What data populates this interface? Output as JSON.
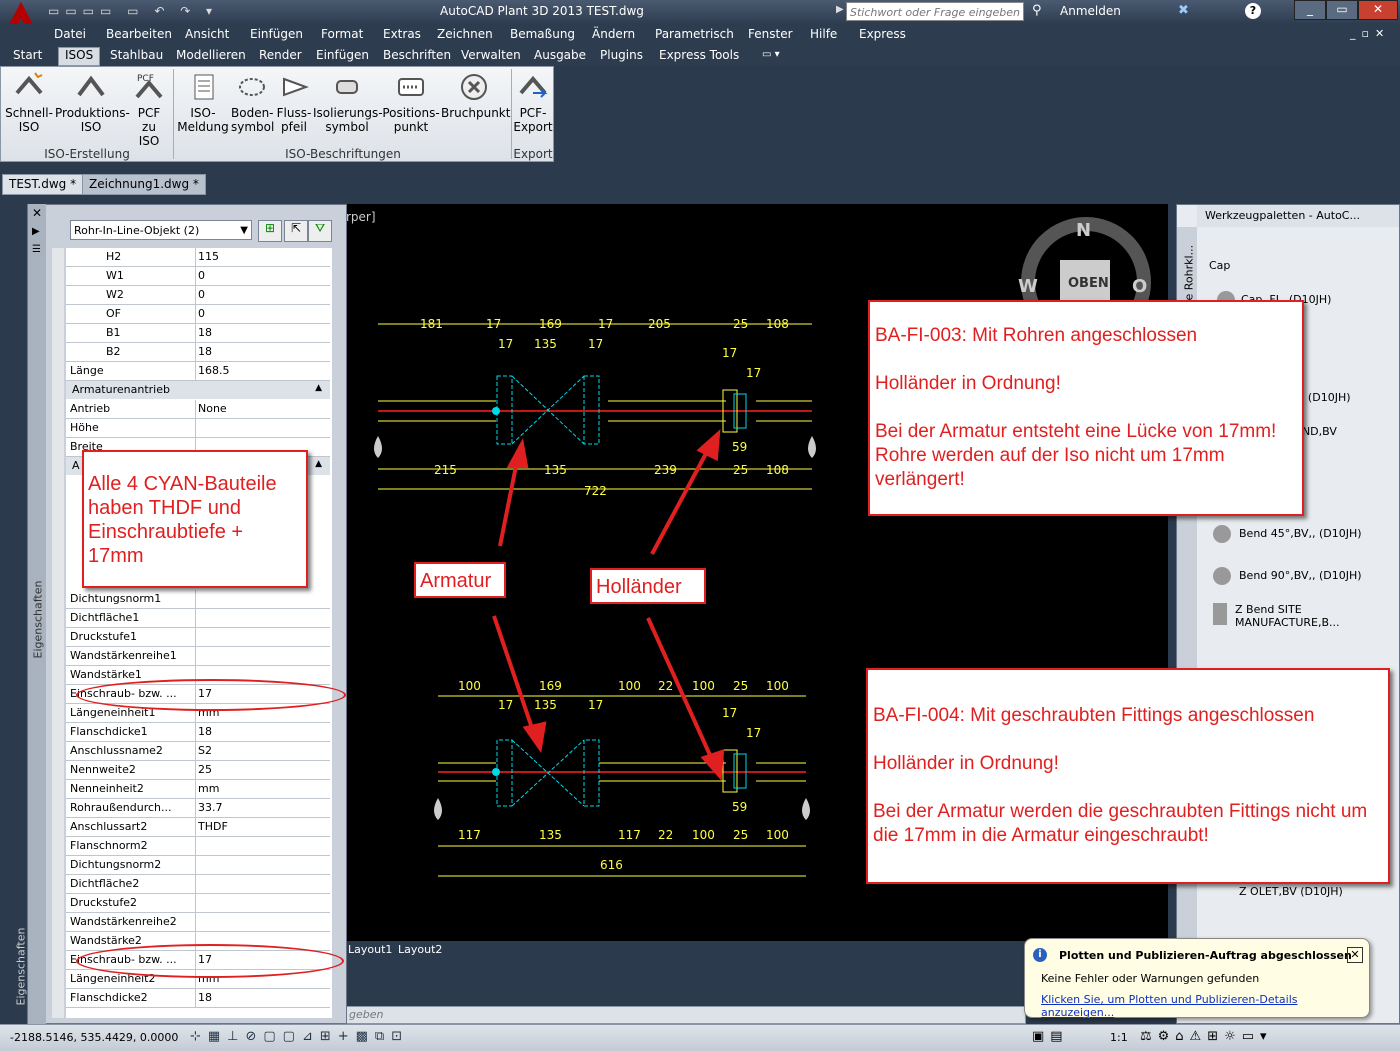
{
  "window": {
    "title": "AutoCAD Plant 3D 2013    TEST.dwg",
    "search_placeholder": "Stichwort oder Frage eingeben",
    "signin": "Anmelden",
    "help_icon": "question-icon"
  },
  "menu": [
    "Datei",
    "Bearbeiten",
    "Ansicht",
    "Einfügen",
    "Format",
    "Extras",
    "Zeichnen",
    "Bemaßung",
    "Ändern",
    "Parametrisch",
    "Fenster",
    "Hilfe",
    "Express"
  ],
  "ribbon_tabs": [
    "Start",
    "ISOS",
    "Stahlbau",
    "Modellieren",
    "Render",
    "Einfügen",
    "Beschriften",
    "Verwalten",
    "Ausgabe",
    "Plugins",
    "Express Tools"
  ],
  "ribbon": {
    "buttons": [
      {
        "l1": "Schnell-",
        "l2": "ISO"
      },
      {
        "l1": "Produktions-",
        "l2": "ISO"
      },
      {
        "l1": "PCF zu",
        "l2": "ISO"
      },
      {
        "l1": "ISO-",
        "l2": "Meldung"
      },
      {
        "l1": "Boden-",
        "l2": "symbol"
      },
      {
        "l1": "Fluss-",
        "l2": "pfeil"
      },
      {
        "l1": "Isolierungs-",
        "l2": "symbol"
      },
      {
        "l1": "Positions-",
        "l2": "punkt"
      },
      {
        "l1": "Bruchpunkt",
        "l2": ""
      },
      {
        "l1": "PCF-",
        "l2": "Export"
      }
    ],
    "groups": [
      "ISO-Erstellung",
      "ISO-Beschriftungen",
      "Export"
    ]
  },
  "doc_tabs": [
    "TEST.dwg *",
    "Zeichnung1.dwg *"
  ],
  "properties": {
    "combo": "Rohr-In-Line-Objekt (2)",
    "rows_top": [
      {
        "k": "H2",
        "v": "115"
      },
      {
        "k": "W1",
        "v": "0"
      },
      {
        "k": "W2",
        "v": "0"
      },
      {
        "k": "OF",
        "v": "0"
      },
      {
        "k": "B1",
        "v": "18"
      },
      {
        "k": "B2",
        "v": "18"
      },
      {
        "k": "Länge",
        "v": "168.5"
      }
    ],
    "group_antrieb": "Armaturenantrieb",
    "rows_antrieb": [
      {
        "k": "Antrieb",
        "v": "None"
      },
      {
        "k": "Höhe",
        "v": ""
      },
      {
        "k": "Breite",
        "v": ""
      }
    ],
    "group_a": "A",
    "rows_bottom": [
      {
        "k": "Dichtungsnorm1",
        "v": ""
      },
      {
        "k": "Dichtfläche1",
        "v": ""
      },
      {
        "k": "Druckstufe1",
        "v": ""
      },
      {
        "k": "Wandstärkenreihe1",
        "v": ""
      },
      {
        "k": "Wandstärke1",
        "v": ""
      },
      {
        "k": "Einschraub- bzw. ...",
        "v": "17"
      },
      {
        "k": "Längeneinheit1",
        "v": "mm"
      },
      {
        "k": "Flanschdicke1",
        "v": "18"
      },
      {
        "k": "Anschlussname2",
        "v": "S2"
      },
      {
        "k": "Nennweite2",
        "v": "25"
      },
      {
        "k": "Nenneinheit2",
        "v": "mm"
      },
      {
        "k": "Rohraußendurch...",
        "v": "33.7"
      },
      {
        "k": "Anschlussart2",
        "v": "THDF"
      },
      {
        "k": "Flanschnorm2",
        "v": ""
      },
      {
        "k": "Dichtungsnorm2",
        "v": ""
      },
      {
        "k": "Dichtfläche2",
        "v": ""
      },
      {
        "k": "Druckstufe2",
        "v": ""
      },
      {
        "k": "Wandstärkenreihe2",
        "v": ""
      },
      {
        "k": "Wandstärke2",
        "v": ""
      },
      {
        "k": "Einschraub- bzw. ...",
        "v": "17"
      },
      {
        "k": "Längeneinheit2",
        "v": "mm"
      },
      {
        "k": "Flanschdicke2",
        "v": "18"
      }
    ],
    "side_label": "Eigenschaften"
  },
  "drawing": {
    "viewport_label": "rper]",
    "compass": {
      "n": "N",
      "w": "W",
      "o": "O",
      "cube": "OBEN"
    },
    "layout_tabs": [
      "Layout1",
      "Layout2"
    ],
    "cmdline": "geben",
    "top_dims_upper": [
      "181",
      "17",
      "169",
      "17",
      "205",
      "25",
      "108"
    ],
    "inner_dims_upper": [
      "17",
      "135",
      "17"
    ],
    "side_dims_upper": [
      "17",
      "17",
      "59"
    ],
    "bottom_dims_upper": [
      "215",
      "135",
      "239",
      "25",
      "108"
    ],
    "total_upper": "722",
    "top_dims_lower": [
      "100",
      "169",
      "100",
      "22",
      "100",
      "25",
      "100"
    ],
    "inner_dims_lower": [
      "17",
      "135",
      "17"
    ],
    "side_dims_lower": [
      "17",
      "17",
      "59"
    ],
    "bottom_dims_lower": [
      "117",
      "135",
      "117",
      "22",
      "100",
      "25",
      "100"
    ],
    "total_lower": "616"
  },
  "callouts": {
    "cyan": "Alle 4 CYAN-Bauteile haben THDF und Einschraubtiefe + 17mm",
    "armatur": "Armatur",
    "hollaender": "Holländer",
    "fi003_title": "BA-FI-003: Mit Rohren angeschlossen",
    "fi003_l2": "Holländer in Ordnung!",
    "fi003_l3": "Bei der Armatur entsteht eine Lücke von 17mm! Rohre werden auf der Iso nicht um 17mm verlängert!",
    "fi004_title": "BA-FI-004: Mit geschraubten Fittings angeschlossen",
    "fi004_l2": "Holländer in Ordnung!",
    "fi004_l3": "Bei der Armatur werden die geschraubten Fittings nicht um die 17mm in die Armatur eingeschraubt!"
  },
  "palette": {
    "title": "Werkzeugpaletten - AutoC...",
    "side_label": "che Rohrkl...",
    "items": [
      "Cap",
      "Cap, FL, (D10JH)",
      ",E,, (D10JH)",
      "END,BV",
      "Bend 45°,BV,, (D10JH)",
      "Bend 90°,BV,, (D10JH)",
      "Z Bend SITE MANUFACTURE,B...",
      "Z OLET,BV (D10JH)"
    ]
  },
  "notification": {
    "title": "Plotten und Publizieren-Auftrag abgeschlossen",
    "line": "Keine Fehler oder Warnungen gefunden",
    "link": "Klicken Sie, um Plotten und Publizieren-Details anzuzeigen..."
  },
  "status": {
    "coords": "-2188.5146, 535.4429, 0.0000",
    "scale": "1:1"
  },
  "colors": {
    "accent_red": "#e02020",
    "cyan": "#00d8e8",
    "yellow": "#ffff40",
    "dim_red": "#ff2020"
  }
}
